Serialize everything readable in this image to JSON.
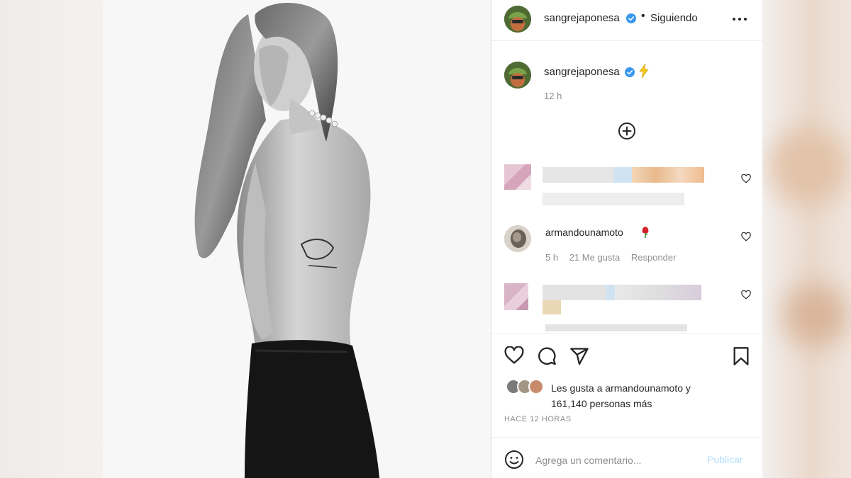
{
  "post": {
    "author": "sangrejaponesa",
    "follow_status": "Siguiendo",
    "separator": "•",
    "caption_time": "12 h"
  },
  "comments": [
    {
      "author": "armandounamoto",
      "time": "5 h",
      "likes": "21 Me gusta",
      "reply": "Responder"
    }
  ],
  "likes": {
    "prefix": "Les gusta a ",
    "user": "armandounamoto",
    "suffix": " y",
    "count_line": "161,140 personas más"
  },
  "post_age": "HACE 12 HORAS",
  "add_comment": {
    "placeholder": "Agrega un comentario...",
    "publish": "Publicar"
  },
  "colors": {
    "verified": "#3897f0",
    "publish_disabled": "#b2dffc",
    "text": "#262626",
    "secondary": "#8e8e8e"
  },
  "icons": [
    "verified-badge-icon",
    "more-options-icon",
    "lightning-icon",
    "add-circle-icon",
    "heart-icon",
    "comment-icon",
    "share-icon",
    "bookmark-icon",
    "emoji-icon",
    "rose-icon"
  ]
}
